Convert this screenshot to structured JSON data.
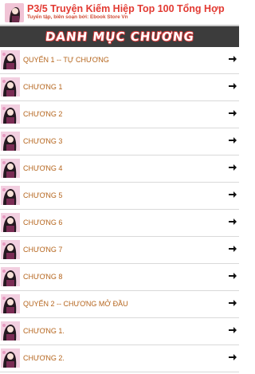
{
  "header": {
    "title": "P3/5 Truyện Kiếm Hiệp Top 100 Tổng Hợp",
    "subtitle": "Tuyển tập, biên soạn bởi: Ebook Store Vn"
  },
  "banner": {
    "text": "DANH MỤC CHƯƠNG"
  },
  "chapters": [
    {
      "label": "QUYỂN 1 -- TỰ CHƯƠNG"
    },
    {
      "label": "CHƯƠNG 1"
    },
    {
      "label": "CHƯƠNG 2"
    },
    {
      "label": "CHƯƠNG 3"
    },
    {
      "label": "CHƯƠNG 4"
    },
    {
      "label": "CHƯƠNG 5"
    },
    {
      "label": "CHƯƠNG 6"
    },
    {
      "label": "CHƯƠNG 7"
    },
    {
      "label": "CHƯƠNG 8"
    },
    {
      "label": "QUYỂN 2 -- CHƯƠNG MỞ ĐẦU"
    },
    {
      "label": "CHƯƠNG 1."
    },
    {
      "label": "CHƯƠNG 2."
    }
  ],
  "icons": {
    "row_thumb": "book-cover-thumbnail-icon",
    "row_arrow": "arrow-right-icon"
  },
  "colors": {
    "title": "#e23a32",
    "banner_bg": "#3c3c3c",
    "chapter_text": "#b5651d"
  }
}
